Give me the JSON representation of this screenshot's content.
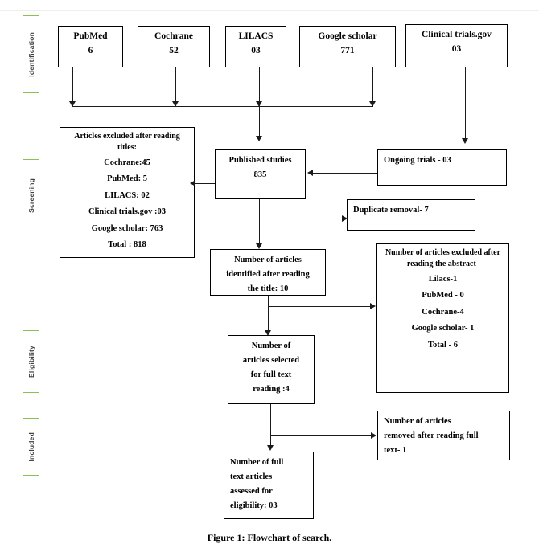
{
  "figure": {
    "caption": "Figure 1: Flowchart of search."
  },
  "phases": [
    {
      "label": "Identification"
    },
    {
      "label": "Screening"
    },
    {
      "label": "Eligibility"
    },
    {
      "label": "Included"
    }
  ],
  "sources": [
    {
      "name": "PubMed",
      "count": "6"
    },
    {
      "name": "Cochrane",
      "count": "52"
    },
    {
      "name": "LILACS",
      "count": "03"
    },
    {
      "name": "Google scholar",
      "count": "771"
    },
    {
      "name": "Clinical trials.gov",
      "count": "03"
    }
  ],
  "excluded_titles": {
    "heading": "Articles excluded after reading titles:",
    "items": [
      "Cochrane:45",
      "PubMed: 5",
      "LILACS:  02",
      "Clinical trials.gov :03",
      "Google scholar: 763",
      "Total : 818"
    ]
  },
  "published_studies": {
    "label": "Published studies",
    "count": "835"
  },
  "ongoing_trials": {
    "label": "Ongoing trials - 03"
  },
  "duplicate_removal": {
    "label": "Duplicate removal- 7"
  },
  "identified_after_title": {
    "line1": "Number of articles",
    "line2": "identified after reading",
    "line3": "the title: 10"
  },
  "excluded_abstract": {
    "heading": "Number of articles excluded after reading the abstract-",
    "items": [
      "Lilacs-1",
      "PubMed - 0",
      "Cochrane-4",
      "Google scholar- 1",
      "Total - 6"
    ]
  },
  "selected_full_text": {
    "line1": "Number of",
    "line2": "articles selected",
    "line3": "for full text",
    "line4": "reading :4"
  },
  "removed_full_text": {
    "line1": "Number of articles",
    "line2": "removed after reading full",
    "line3": "text- 1"
  },
  "assessed_eligibility": {
    "line1": "Number of full",
    "line2": "text articles",
    "line3": "assessed for",
    "line4": "eligibility: 03"
  },
  "colors": {
    "phase_border": "#8cc152",
    "box_border": "#000000",
    "connector": "#1a1a1a",
    "background": "#ffffff",
    "text": "#000000"
  }
}
